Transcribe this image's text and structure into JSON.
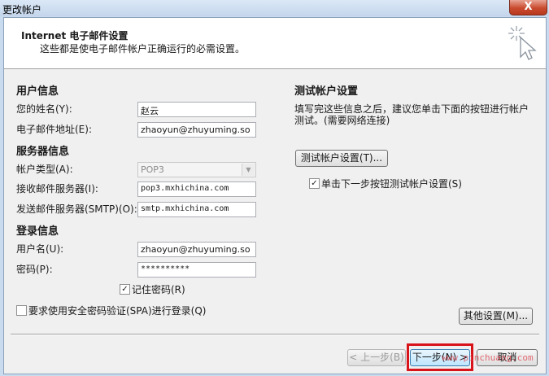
{
  "window": {
    "title": "更改帐户",
    "close_label": "X"
  },
  "header": {
    "title": "Internet 电子邮件设置",
    "subtitle": "这些都是使电子邮件帐户正确运行的必需设置。"
  },
  "user_info": {
    "heading": "用户信息",
    "name_label": "您的姓名(Y):",
    "name_value": "赵云",
    "email_label": "电子邮件地址(E):",
    "email_value": "zhaoyun@zhuyuming.so"
  },
  "server_info": {
    "heading": "服务器信息",
    "type_label": "帐户类型(A):",
    "type_value": "POP3",
    "incoming_label": "接收邮件服务器(I):",
    "incoming_value": "pop3.mxhichina.com",
    "outgoing_label": "发送邮件服务器(SMTP)(O):",
    "outgoing_value": "smtp.mxhichina.com"
  },
  "login_info": {
    "heading": "登录信息",
    "username_label": "用户名(U):",
    "username_value": "zhaoyun@zhuyuming.so",
    "password_label": "密码(P):",
    "password_value": "**********",
    "remember_label": "记住密码(R)",
    "spa_label": "要求使用安全密码验证(SPA)进行登录(Q)"
  },
  "test_settings": {
    "heading": "测试帐户设置",
    "description_line1": "填写完这些信息之后，建议您单击下面的按钮进行帐户",
    "description_line2": "测试。(需要网络连接)",
    "test_button": "测试帐户设置(T)...",
    "auto_test_label": "单击下一步按钮测试帐户设置(S)",
    "more_button": "其他设置(M)..."
  },
  "footer": {
    "back_button": "< 上一步(B)",
    "next_button": "下一步(N) >",
    "cancel_button": "取消"
  },
  "checkbox_state": {
    "remember_password": true,
    "require_spa": false,
    "test_on_next": true
  },
  "watermark": "www.pinchuang.com",
  "colors": {
    "highlight": "#d8131a",
    "title_bar": "#c4d6ec",
    "close_button": "#c94b2f"
  },
  "icons": {
    "wizard": "wizard-sparkle-icon",
    "dropdown": "chevron-down-icon",
    "check": "checkmark-icon"
  }
}
